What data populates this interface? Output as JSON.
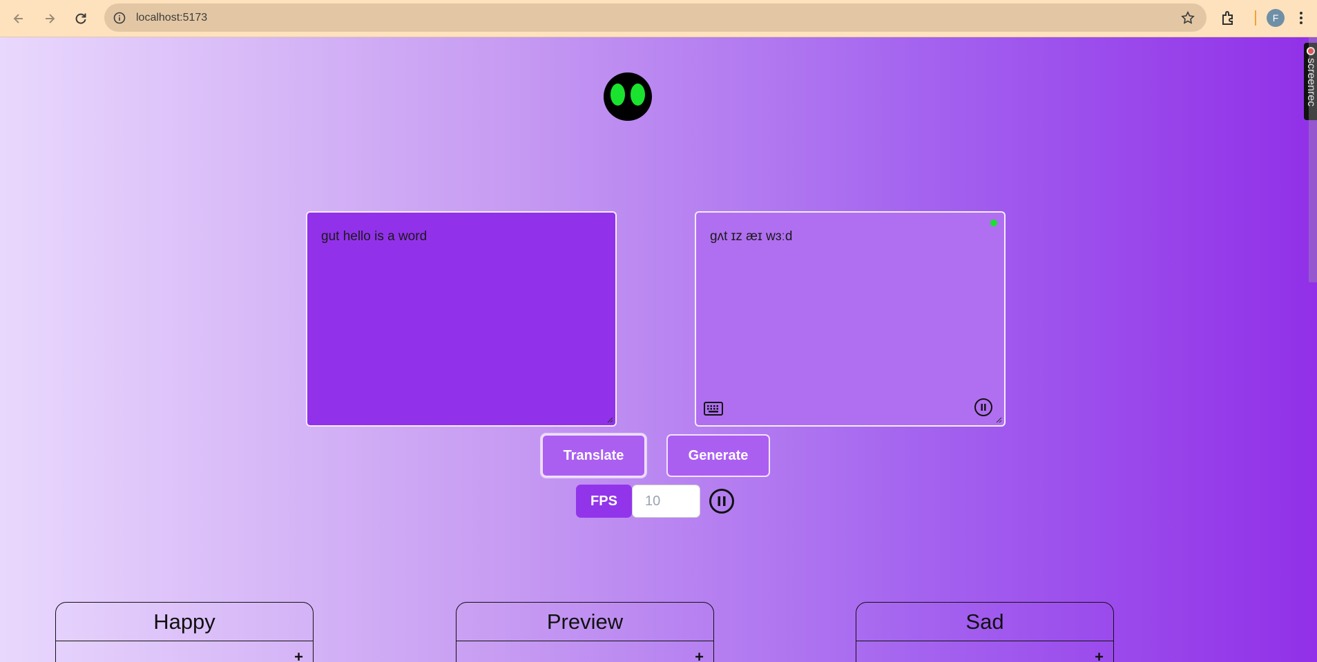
{
  "browser": {
    "url": "localhost:5173",
    "profile_initial": "F"
  },
  "badge": {
    "text": "screenrec"
  },
  "editor": {
    "input_text": "gut hello is a word",
    "output_text": "gʌt  ɪz æɪ wɜːd"
  },
  "buttons": {
    "translate_label": "Translate",
    "generate_label": "Generate"
  },
  "fps": {
    "label": "FPS",
    "placeholder": "10"
  },
  "cards": {
    "happy_title": "Happy",
    "preview_title": "Preview",
    "sad_title": "Sad",
    "marker": "+"
  },
  "colors": {
    "accent": "#9231ea",
    "button": "#ab5ff1",
    "eye_green": "#19e32e",
    "status_dot": "#19e32e"
  },
  "icons": [
    "back-arrow-icon",
    "forward-arrow-icon",
    "reload-icon",
    "info-icon",
    "star-icon",
    "extensions-icon",
    "menu-icon",
    "keyboard-icon",
    "pause-icon"
  ]
}
